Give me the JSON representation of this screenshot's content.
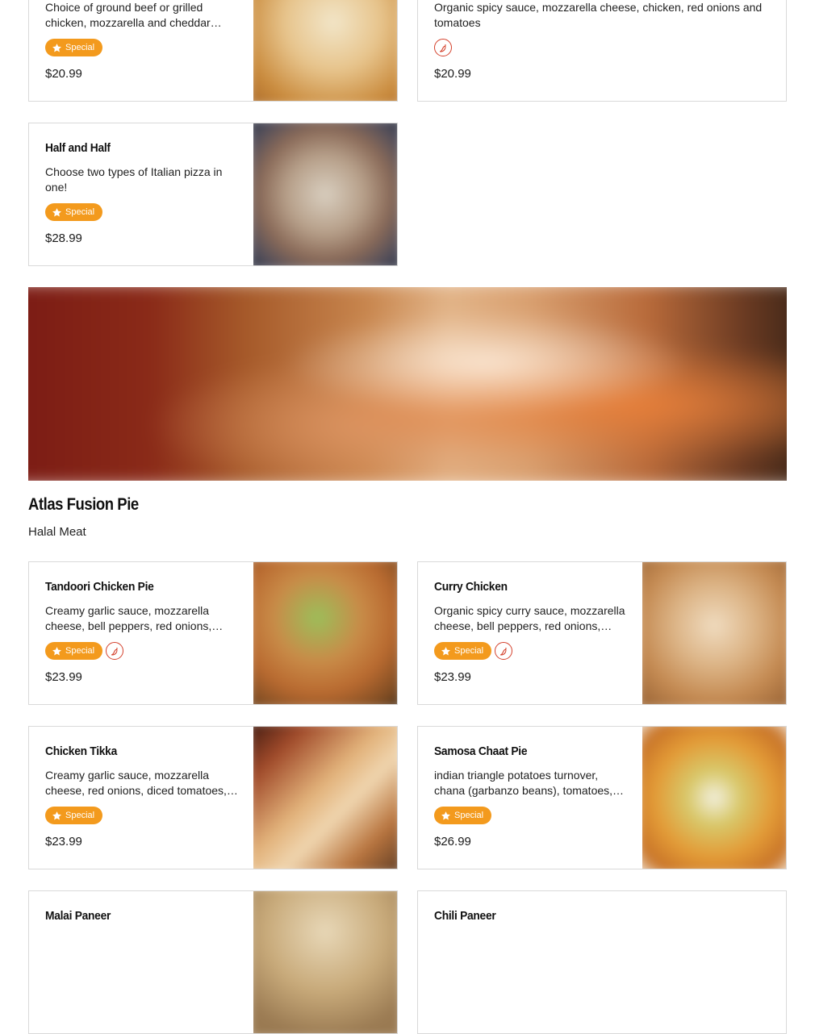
{
  "cards_top": [
    {
      "title": "",
      "description": "Choice of ground beef or grilled chicken, mozzarella and cheddar cheese, tomatoes",
      "special": true,
      "spicy": false,
      "price": "$20.99"
    },
    {
      "title": "",
      "description": "Organic spicy sauce, mozzarella cheese, chicken, red onions and tomatoes",
      "special": false,
      "spicy": true,
      "price": "$20.99"
    },
    {
      "title": "Half and Half",
      "description": "Choose two types of Italian pizza in one!",
      "special": true,
      "spicy": false,
      "price": "$28.99"
    }
  ],
  "badge": {
    "special_label": "Special"
  },
  "section": {
    "title": "Atlas Fusion Pie",
    "subtitle": "Halal Meat"
  },
  "cards_section": [
    {
      "title": "Tandoori Chicken Pie",
      "description": "Creamy garlic sauce, mozzarella cheese, bell peppers, red onions, tandoori chicken",
      "special": true,
      "spicy": true,
      "price": "$23.99"
    },
    {
      "title": "Curry Chicken",
      "description": "Organic spicy curry sauce, mozzarella cheese, bell peppers, red onions, curry chicken",
      "special": true,
      "spicy": true,
      "price": "$23.99"
    },
    {
      "title": "Chicken Tikka",
      "description": "Creamy garlic sauce, mozzarella cheese, red onions, diced tomatoes, chicken tikka",
      "special": true,
      "spicy": false,
      "price": "$23.99"
    },
    {
      "title": "Samosa Chaat Pie",
      "description": "indian triangle potatoes turnover, chana (garbanzo beans), tomatoes, onions",
      "special": true,
      "spicy": false,
      "price": "$26.99"
    },
    {
      "title": "Malai Paneer",
      "description": "",
      "special": false,
      "spicy": false,
      "price": ""
    },
    {
      "title": "Chili Paneer",
      "description": "",
      "special": false,
      "spicy": false,
      "price": ""
    }
  ],
  "icons": {
    "special": "star-badge-icon",
    "spicy": "chili-pepper-icon"
  },
  "colors": {
    "accent": "#f39a1d",
    "spicy": "#d4402b",
    "border": "#d9d9d9"
  }
}
